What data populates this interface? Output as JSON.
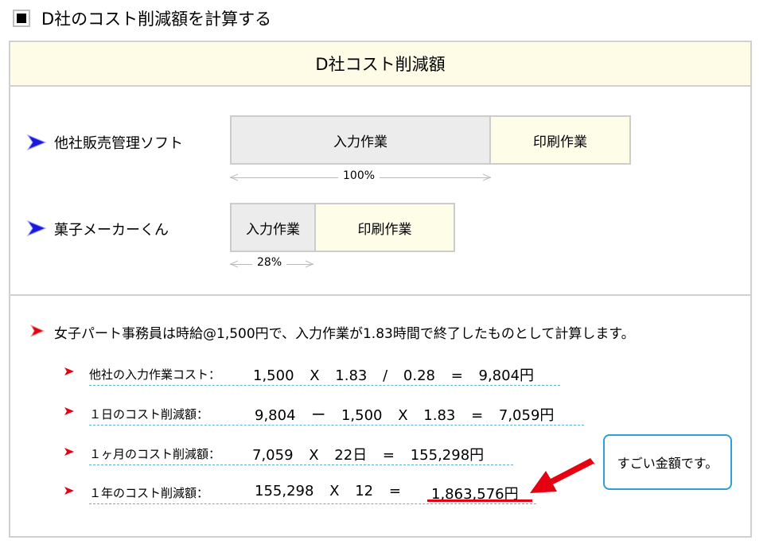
{
  "page_title": "D社のコスト削減額を計算する",
  "panel": {
    "heading": "D社コスト削減額",
    "comparisons": [
      {
        "label": "他社販売管理ソフト",
        "input_label": "入力作業",
        "print_label": "印刷作業",
        "percent_text": "100%",
        "input_share": 1.0
      },
      {
        "label": "菓子メーカーくん",
        "input_label": "入力作業",
        "print_label": "印刷作業",
        "percent_text": "28%",
        "input_share": 0.28
      }
    ],
    "calculation": {
      "intro": "女子パート事務員は時給@1,500円で、入力作業が1.83時間で終了したものとして計算します。",
      "rows": [
        {
          "label": "他社の入力作業コスト：",
          "expression": "1,500 X 1.83 / 0.28 = 9,804円"
        },
        {
          "label": "１日のコスト削減額：",
          "expression": "9,804 ー 1,500 X 1.83 = 7,059円"
        },
        {
          "label": "１ヶ月のコスト削減額：",
          "expression": "7,059 X 22日 = 155,298円"
        },
        {
          "label": "１年のコスト削減額：",
          "expression": "155,298 X 12 =",
          "result": "1,863,576円"
        }
      ]
    },
    "callout": "すごい金額です。"
  },
  "colors": {
    "bullet_blue": "#1a1adc",
    "bullet_red": "#e50012",
    "callout_border": "#2c9fd8",
    "highlight": "#e50012"
  }
}
